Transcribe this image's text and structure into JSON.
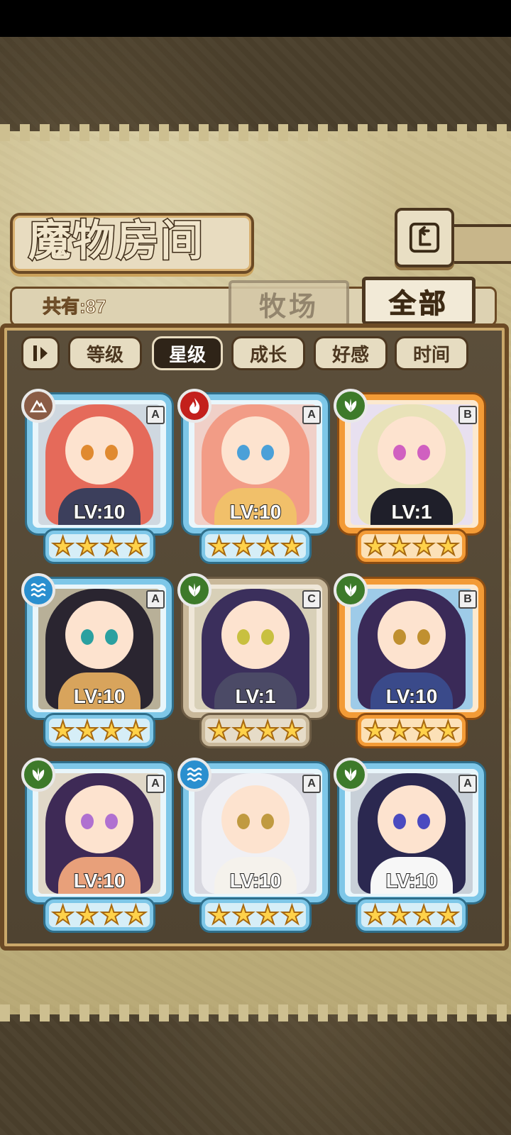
{
  "header": {
    "title": "魔物房间",
    "back_icon": "back-arrow-icon"
  },
  "summary": {
    "count_label": "共有:87"
  },
  "tabs": {
    "ranch": "牧场",
    "all": "全部",
    "active": "全部"
  },
  "sort": {
    "toggle_icon": "sort-toggle-icon",
    "options": [
      "等级",
      "星级",
      "成长",
      "好感",
      "时间"
    ],
    "active": "星级"
  },
  "monsters": [
    {
      "level": "LV:10",
      "rank": "A",
      "element": "earth",
      "stars": 4,
      "frame": "blue"
    },
    {
      "level": "LV:10",
      "rank": "A",
      "element": "fire",
      "stars": 4,
      "frame": "blue"
    },
    {
      "level": "LV:1",
      "rank": "B",
      "element": "leaf",
      "stars": 4,
      "frame": "orange"
    },
    {
      "level": "LV:10",
      "rank": "A",
      "element": "water",
      "stars": 4,
      "frame": "blue"
    },
    {
      "level": "LV:1",
      "rank": "C",
      "element": "leaf",
      "stars": 4,
      "frame": "tan"
    },
    {
      "level": "LV:10",
      "rank": "B",
      "element": "leaf",
      "stars": 4,
      "frame": "orange"
    },
    {
      "level": "LV:10",
      "rank": "A",
      "element": "leaf",
      "stars": 4,
      "frame": "blue"
    },
    {
      "level": "LV:10",
      "rank": "A",
      "element": "water",
      "stars": 4,
      "frame": "blue"
    },
    {
      "level": "LV:10",
      "rank": "A",
      "element": "leaf",
      "stars": 4,
      "frame": "blue"
    }
  ],
  "colors": {
    "frame_blue": "#7ec7e8",
    "frame_orange": "#f39b36",
    "frame_tan": "#c9b89a",
    "star": "#ffd24a",
    "element_earth": "#8a5c46",
    "element_fire": "#c3201c",
    "element_leaf": "#3d7a2a",
    "element_water": "#2a8fcf"
  }
}
